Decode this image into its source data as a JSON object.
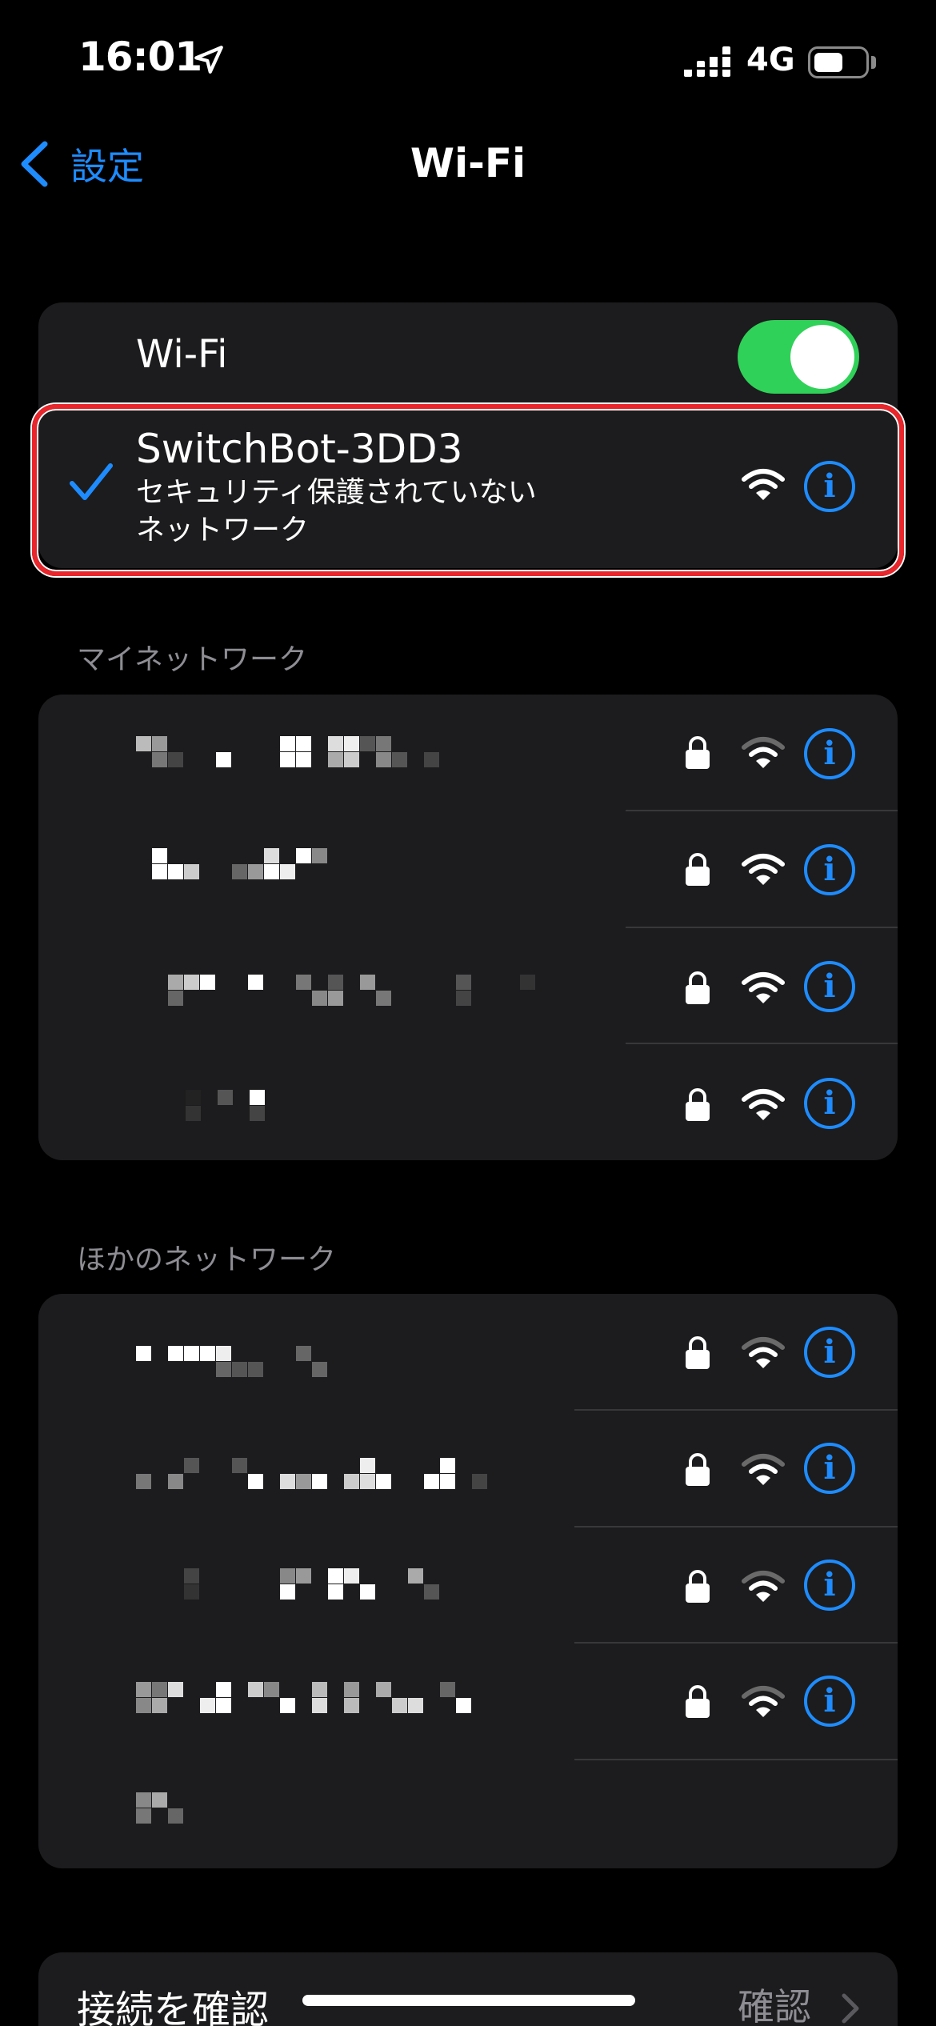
{
  "status_bar": {
    "time": "16:01",
    "network": "4G",
    "battery_percent": 55
  },
  "nav": {
    "back_label": "設定",
    "title": "Wi-Fi"
  },
  "wifi_toggle": {
    "label": "Wi-Fi",
    "on": true
  },
  "connected": {
    "name": "SwitchBot-3DD3",
    "subtitle_line1": "セキュリティ保護されていない",
    "subtitle_line2": "ネットワーク"
  },
  "my_networks": {
    "header": "マイネットワーク"
  },
  "other_networks": {
    "header": "ほかのネットワーク"
  },
  "check_connection": {
    "label": "接続を確認",
    "value": "確認"
  },
  "icons": {
    "back": "chevron-left-icon",
    "location": "location-arrow-icon",
    "signal": "cellular-signal-icon",
    "battery": "battery-icon",
    "check": "checkmark-icon",
    "wifi": "wifi-icon",
    "lock": "lock-icon",
    "info": "info-icon",
    "chevron": "chevron-right-icon"
  },
  "colors": {
    "accent": "#1e8cff",
    "toggle_on": "#30d158",
    "card": "#1c1c1e",
    "highlight": "#e8262b"
  }
}
